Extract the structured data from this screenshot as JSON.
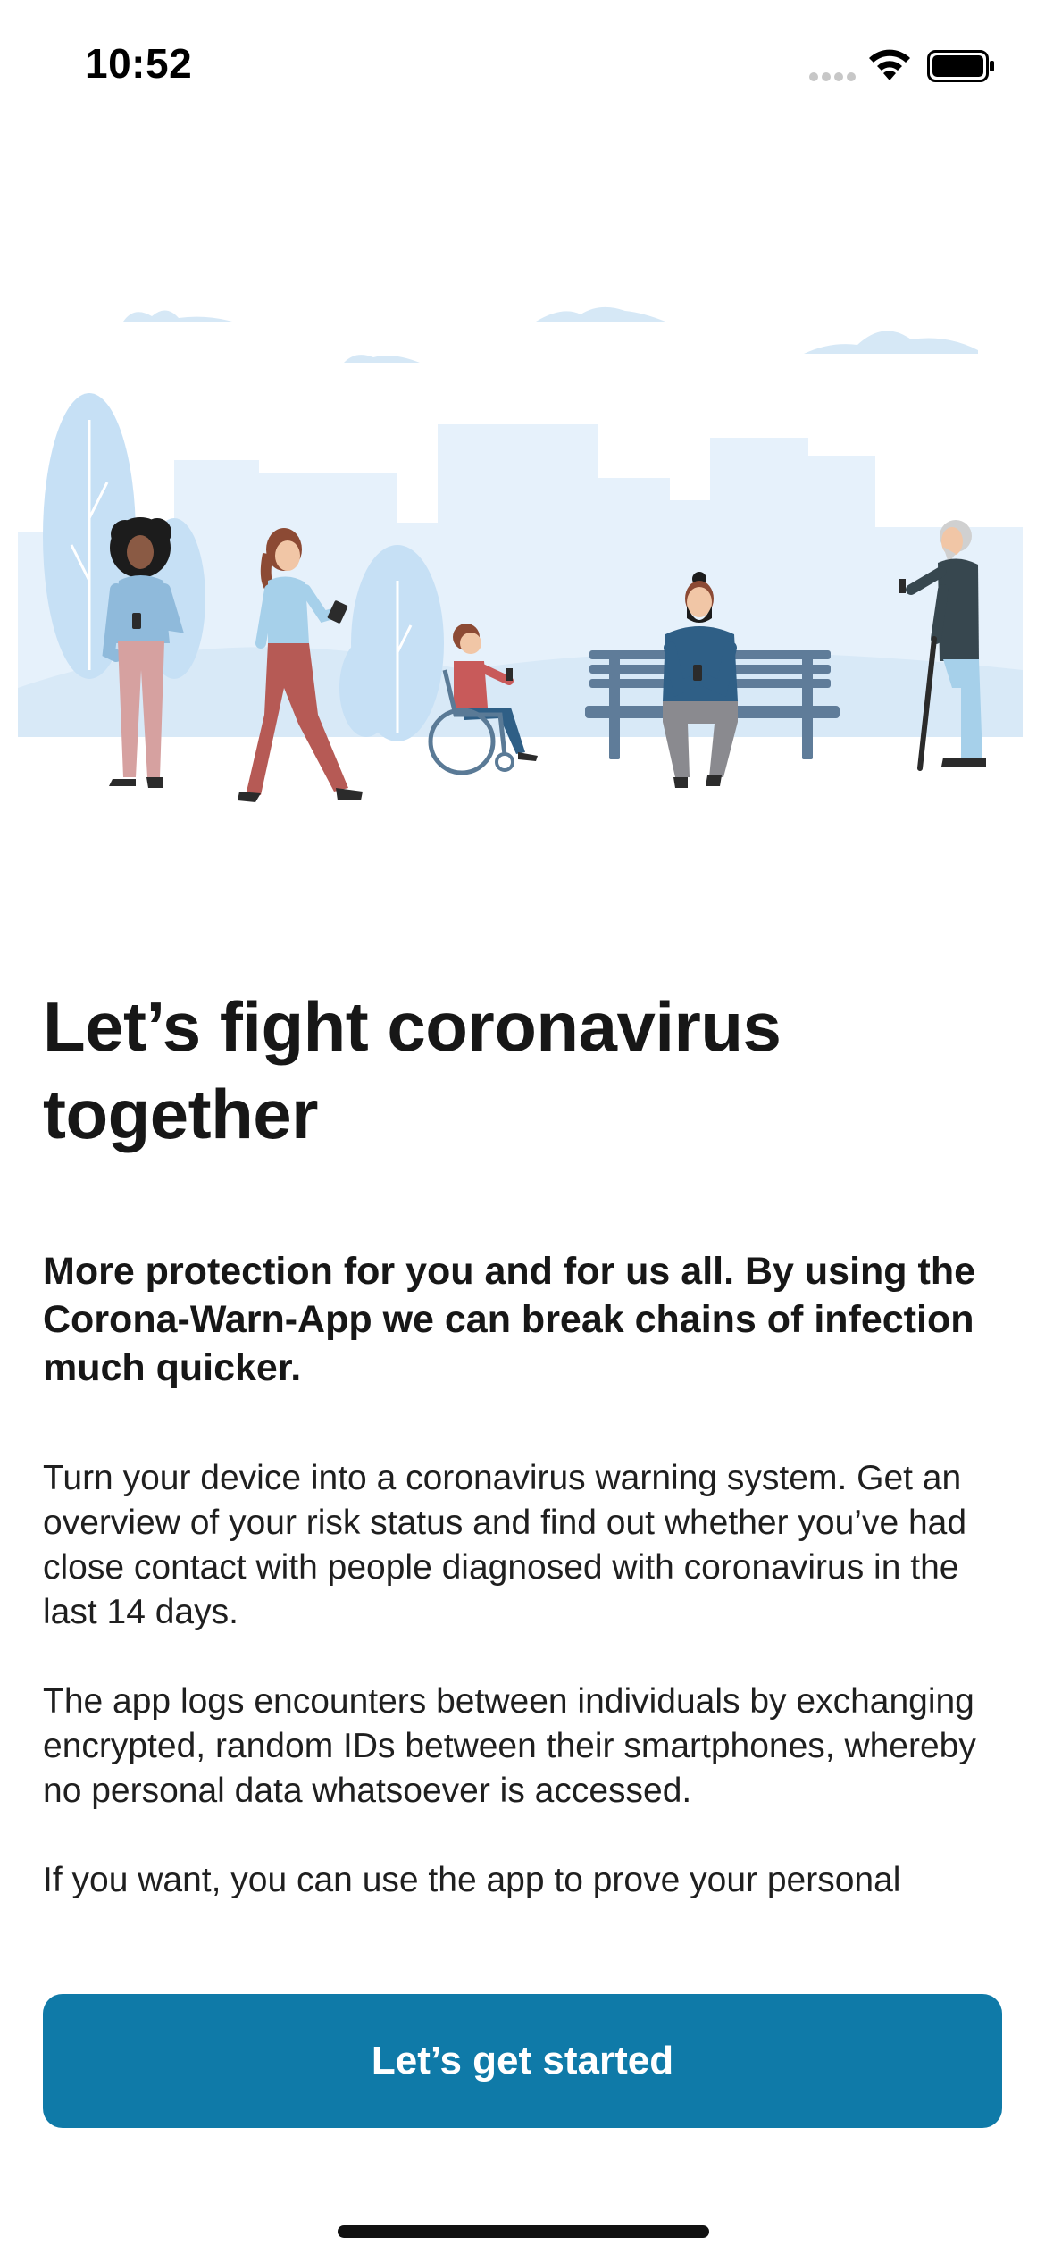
{
  "status_bar": {
    "time": "10:52",
    "icons": [
      "cellular-signal-icon",
      "wifi-icon",
      "battery-icon"
    ]
  },
  "illustration": {
    "icon": "people-in-park-illustration"
  },
  "onboarding": {
    "title": "Let’s fight coronavirus together",
    "subtitle": "More protection for you and for us all. By using the Corona-Warn-App we can break chains of infection much quicker.",
    "paragraph_1": "Turn your device into a coronavirus warning system. Get an overview of your risk status and find out whether you’ve had close contact with people diagnosed with coronavirus in the last 14 days.",
    "paragraph_2": "The app logs encounters between individuals by exchanging encrypted, random IDs between their smartphones, whereby no personal data whatsoever is accessed.",
    "paragraph_3": "If you want, you can use the app to prove your personal"
  },
  "primary_button": {
    "label": "Let’s get started"
  },
  "colors": {
    "accent": "#0f7aa8",
    "text": "#171717",
    "sky": "#e4f0fa",
    "tree": "#bfdcf3"
  }
}
